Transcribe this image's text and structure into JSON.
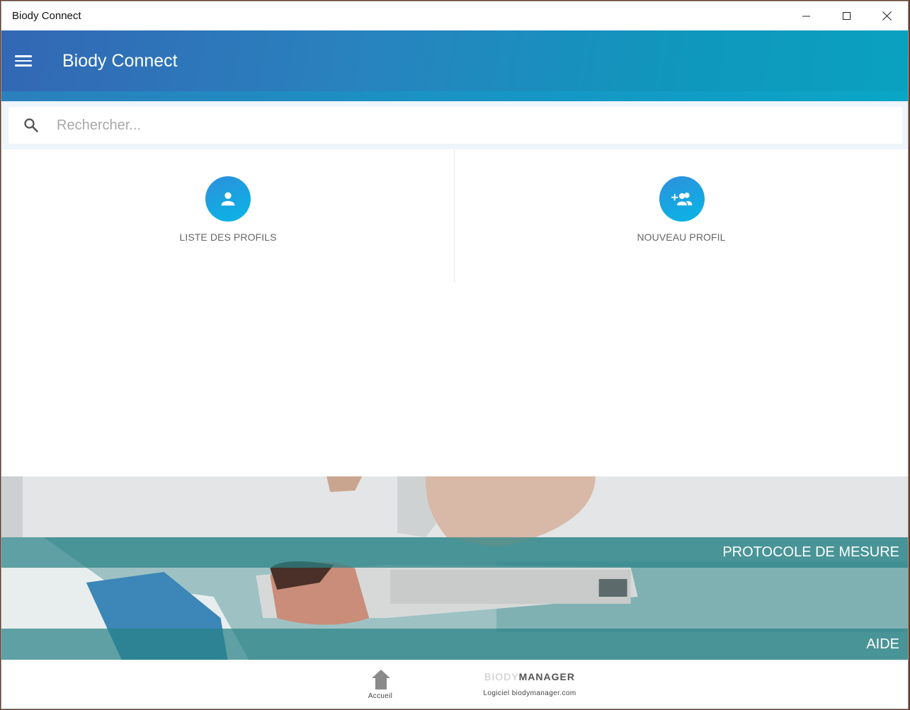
{
  "window": {
    "title": "Biody Connect",
    "controls": [
      "minimize-icon",
      "maximize-icon",
      "close-icon"
    ]
  },
  "appbar": {
    "title": "Biody Connect",
    "menu_icon": "hamburger-menu-icon",
    "colors": {
      "gradient_start": "#3367b4",
      "gradient_end": "#0aa1c0"
    }
  },
  "search": {
    "placeholder": "Rechercher...",
    "value": "",
    "icon": "search-icon"
  },
  "tiles": [
    {
      "label": "LISTE DES PROFILS",
      "icon": "person-icon"
    },
    {
      "label": "NOUVEAU PROFIL",
      "icon": "add-group-icon"
    }
  ],
  "banner": {
    "protocol_label": "PROTOCOLE DE MESURE",
    "aide_label": "AIDE",
    "band_color": "#28828a"
  },
  "footer": {
    "home_label": "Accueil",
    "brand_light": "BIODY",
    "brand_bold": "MANAGER",
    "brand_link": "Logiciel biodymanager.com"
  }
}
